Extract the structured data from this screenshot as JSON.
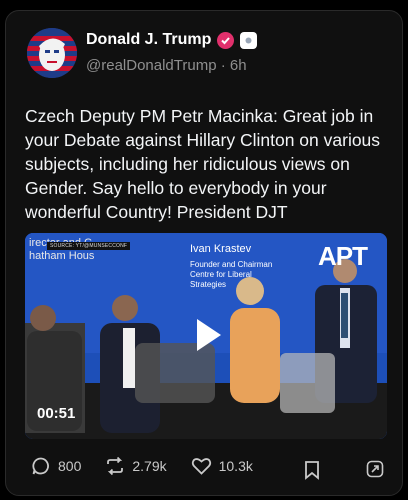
{
  "author": {
    "name": "Donald J. Trump",
    "handle": "@realDonaldTrump",
    "time": "6h"
  },
  "post": {
    "text": "Czech Deputy PM Petr Macinka: Great job in your Debate against Hillary Clinton on various subjects, including her ridiculous views on Gender. Say hello to everybody in your wonderful Country! President DJT"
  },
  "video": {
    "overlay_text_line1": "irector and C",
    "overlay_text_line2": "hatham Hous",
    "source_tag": "SOURCE: YT/@MUNSECCONF",
    "speaker_name": "Ivan Krastev",
    "speaker_title": "Founder and Chairman Centre for Liberal Strategies",
    "channel_logo": "APT",
    "duration": "00:51",
    "play_icon": "play-icon"
  },
  "actions": {
    "replies": "800",
    "reposts": "2.79k",
    "likes": "10.3k"
  },
  "colors": {
    "card_bg": "#101010",
    "text": "#f3f5f7",
    "muted": "#8f8f8f",
    "verified": "#e1306c",
    "video_bg": "#1d4fb8"
  }
}
